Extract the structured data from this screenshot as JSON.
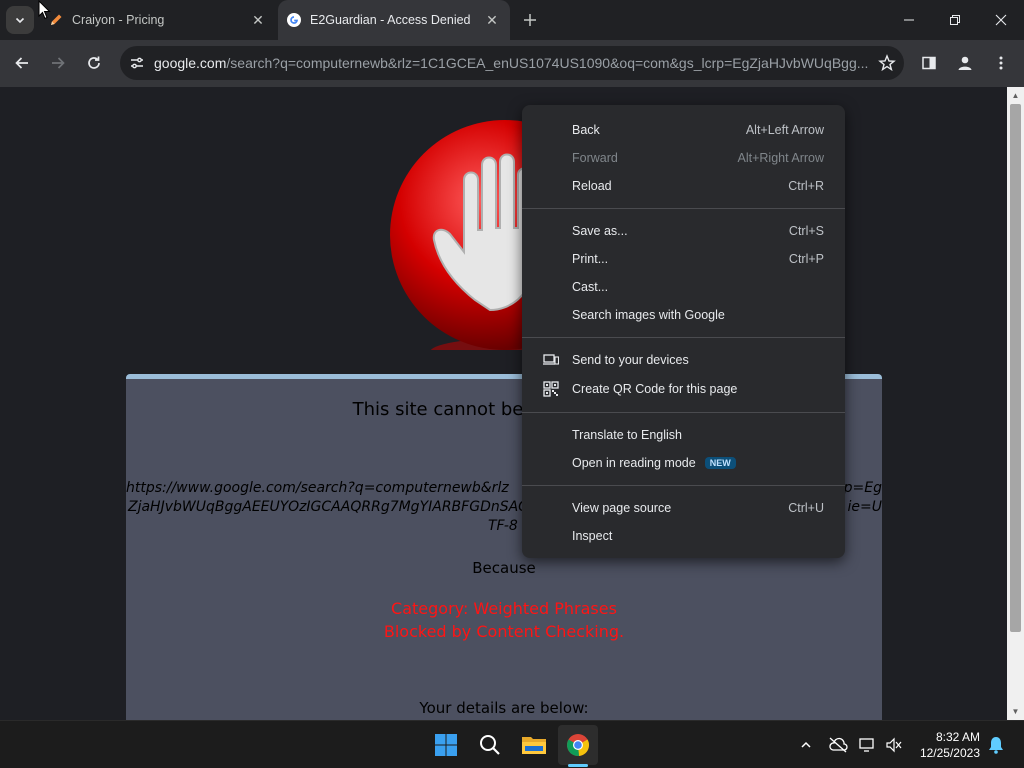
{
  "tabs": [
    {
      "title": "Craiyon - Pricing",
      "favicon": "pencil-icon",
      "active": false
    },
    {
      "title": "E2Guardian - Access Denied",
      "favicon": "google-g-icon",
      "active": true
    }
  ],
  "omnibox": {
    "host": "google.com",
    "path": "/search?q=computernewb&rlz=1C1GCEA_enUS1074US1090&oq=com&gs_lcrp=EgZjaHJvbWUqBgg..."
  },
  "page": {
    "headline": "This site cannot be viewed at this",
    "blocked_url_line1": "https://www.google.com/search?q=computernewb&rlz",
    "blocked_url_line1_tail": "p=Eg",
    "blocked_url_line2": "ZjaHJvbWUqBggAEEUYOzIGCAAQRRg7MgYIARBFGDnSAC",
    "blocked_url_line2_tail": "ie=U",
    "blocked_url_line3": "TF-8",
    "because": "Because",
    "reason_line1": "Category: Weighted Phrases",
    "reason_line2": "Blocked by Content Checking.",
    "details": "Your details are below:"
  },
  "context_menu": {
    "items": [
      {
        "label": "Back",
        "shortcut": "Alt+Left Arrow",
        "disabled": false
      },
      {
        "label": "Forward",
        "shortcut": "Alt+Right Arrow",
        "disabled": true
      },
      {
        "label": "Reload",
        "shortcut": "Ctrl+R",
        "disabled": false
      },
      {
        "label": "Save as...",
        "shortcut": "Ctrl+S",
        "disabled": false
      },
      {
        "label": "Print...",
        "shortcut": "Ctrl+P",
        "disabled": false
      },
      {
        "label": "Cast...",
        "shortcut": "",
        "disabled": false
      },
      {
        "label": "Search images with Google",
        "shortcut": "",
        "disabled": false
      },
      {
        "label": "Send to your devices",
        "shortcut": "",
        "disabled": false,
        "icon": "devices-icon"
      },
      {
        "label": "Create QR Code for this page",
        "shortcut": "",
        "disabled": false,
        "icon": "qr-code-icon"
      },
      {
        "label": "Translate to English",
        "shortcut": "",
        "disabled": false
      },
      {
        "label": "Open in reading mode",
        "shortcut": "",
        "disabled": false,
        "badge": "NEW"
      },
      {
        "label": "View page source",
        "shortcut": "Ctrl+U",
        "disabled": false
      },
      {
        "label": "Inspect",
        "shortcut": "",
        "disabled": false
      }
    ]
  },
  "taskbar": {
    "time": "8:32 AM",
    "date": "12/25/2023"
  },
  "colors": {
    "reason_red": "#ff1414",
    "panel_bg": "#4c5060",
    "panel_top_border": "#9bbdd9",
    "menu_bg": "#292a2d",
    "badge_bg": "#0c4f79"
  }
}
